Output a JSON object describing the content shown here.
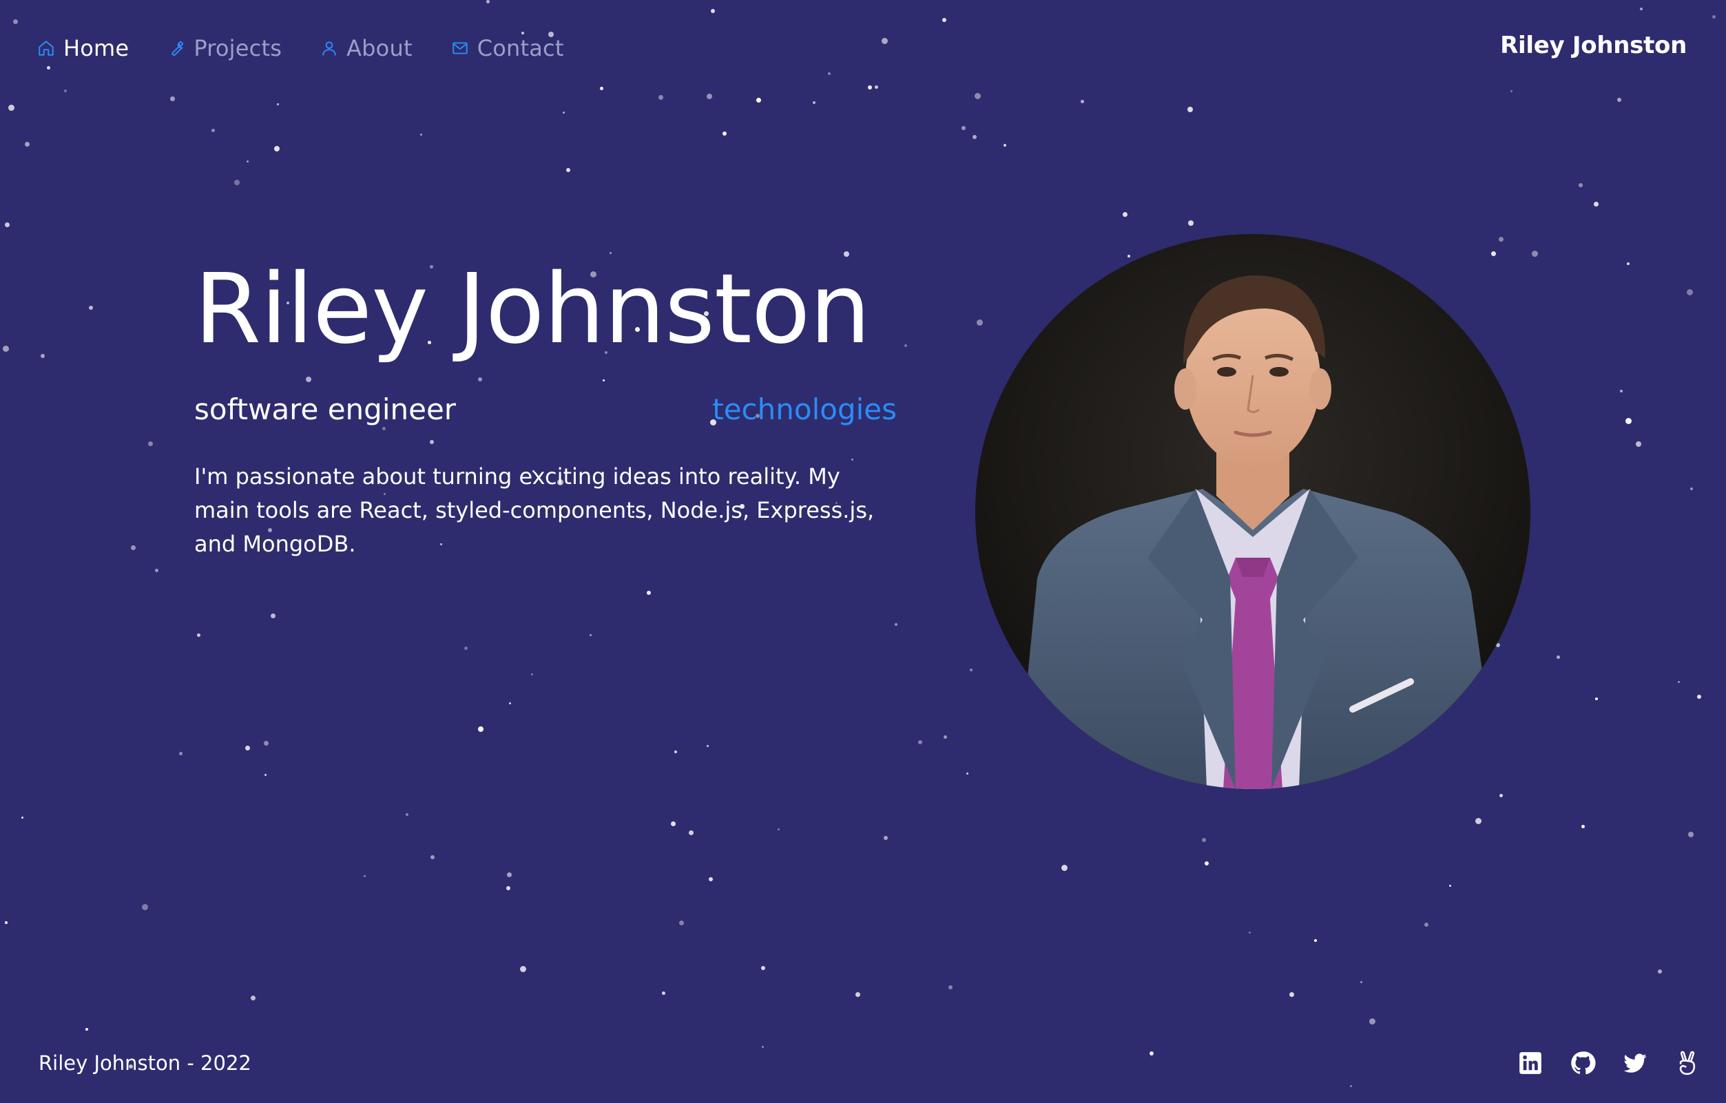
{
  "nav": {
    "items": [
      {
        "label": "Home",
        "icon": "home-icon",
        "active": true
      },
      {
        "label": "Projects",
        "icon": "wrench-icon",
        "active": false
      },
      {
        "label": "About",
        "icon": "user-icon",
        "active": false
      },
      {
        "label": "Contact",
        "icon": "mail-icon",
        "active": false
      }
    ],
    "brand": "Riley Johnston"
  },
  "hero": {
    "title": "Riley Johnston",
    "role": "software engineer",
    "technologies_link": "technologies",
    "description": "I'm passionate about turning exciting ideas into reality. My main tools are React, styled-components, Node.js, Express.js, and MongoDB."
  },
  "footer": {
    "copyright": "Riley Johnston - 2022",
    "social": [
      {
        "name": "linkedin-icon"
      },
      {
        "name": "github-icon"
      },
      {
        "name": "twitter-icon"
      },
      {
        "name": "angellist-icon"
      }
    ]
  },
  "colors": {
    "background": "#2e2c6e",
    "accent": "#2b8cf6",
    "nav_inactive": "#9aa0c8",
    "text": "#ffffff"
  }
}
